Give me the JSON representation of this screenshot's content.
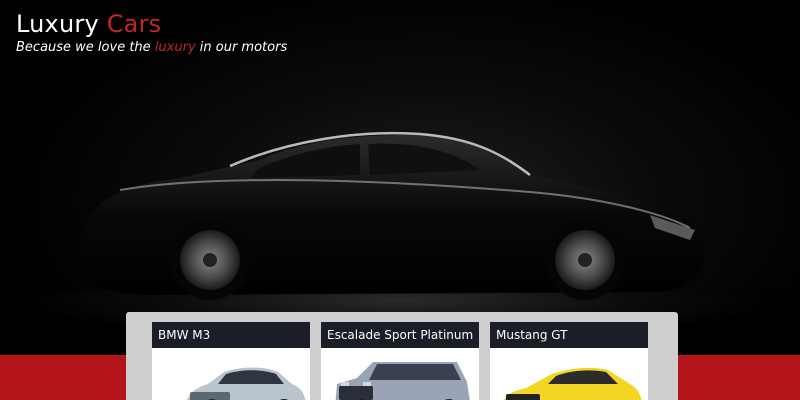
{
  "brand": {
    "title_main": "Luxury",
    "title_accent": "Cars",
    "tagline_start": "Because we love the",
    "tagline_accent": "luxury",
    "tagline_end": "in our motors",
    "accent_color": "#c0262c"
  },
  "hero": {
    "image": "black-luxury-sedan-silhouette"
  },
  "cars": [
    {
      "name": "BMW M3",
      "image": "silver-bmw-sedan"
    },
    {
      "name": "Escalade Sport Platinum",
      "image": "silver-cadillac-suv"
    },
    {
      "name": "Mustang GT",
      "image": "yellow-mustang-coupe"
    }
  ]
}
